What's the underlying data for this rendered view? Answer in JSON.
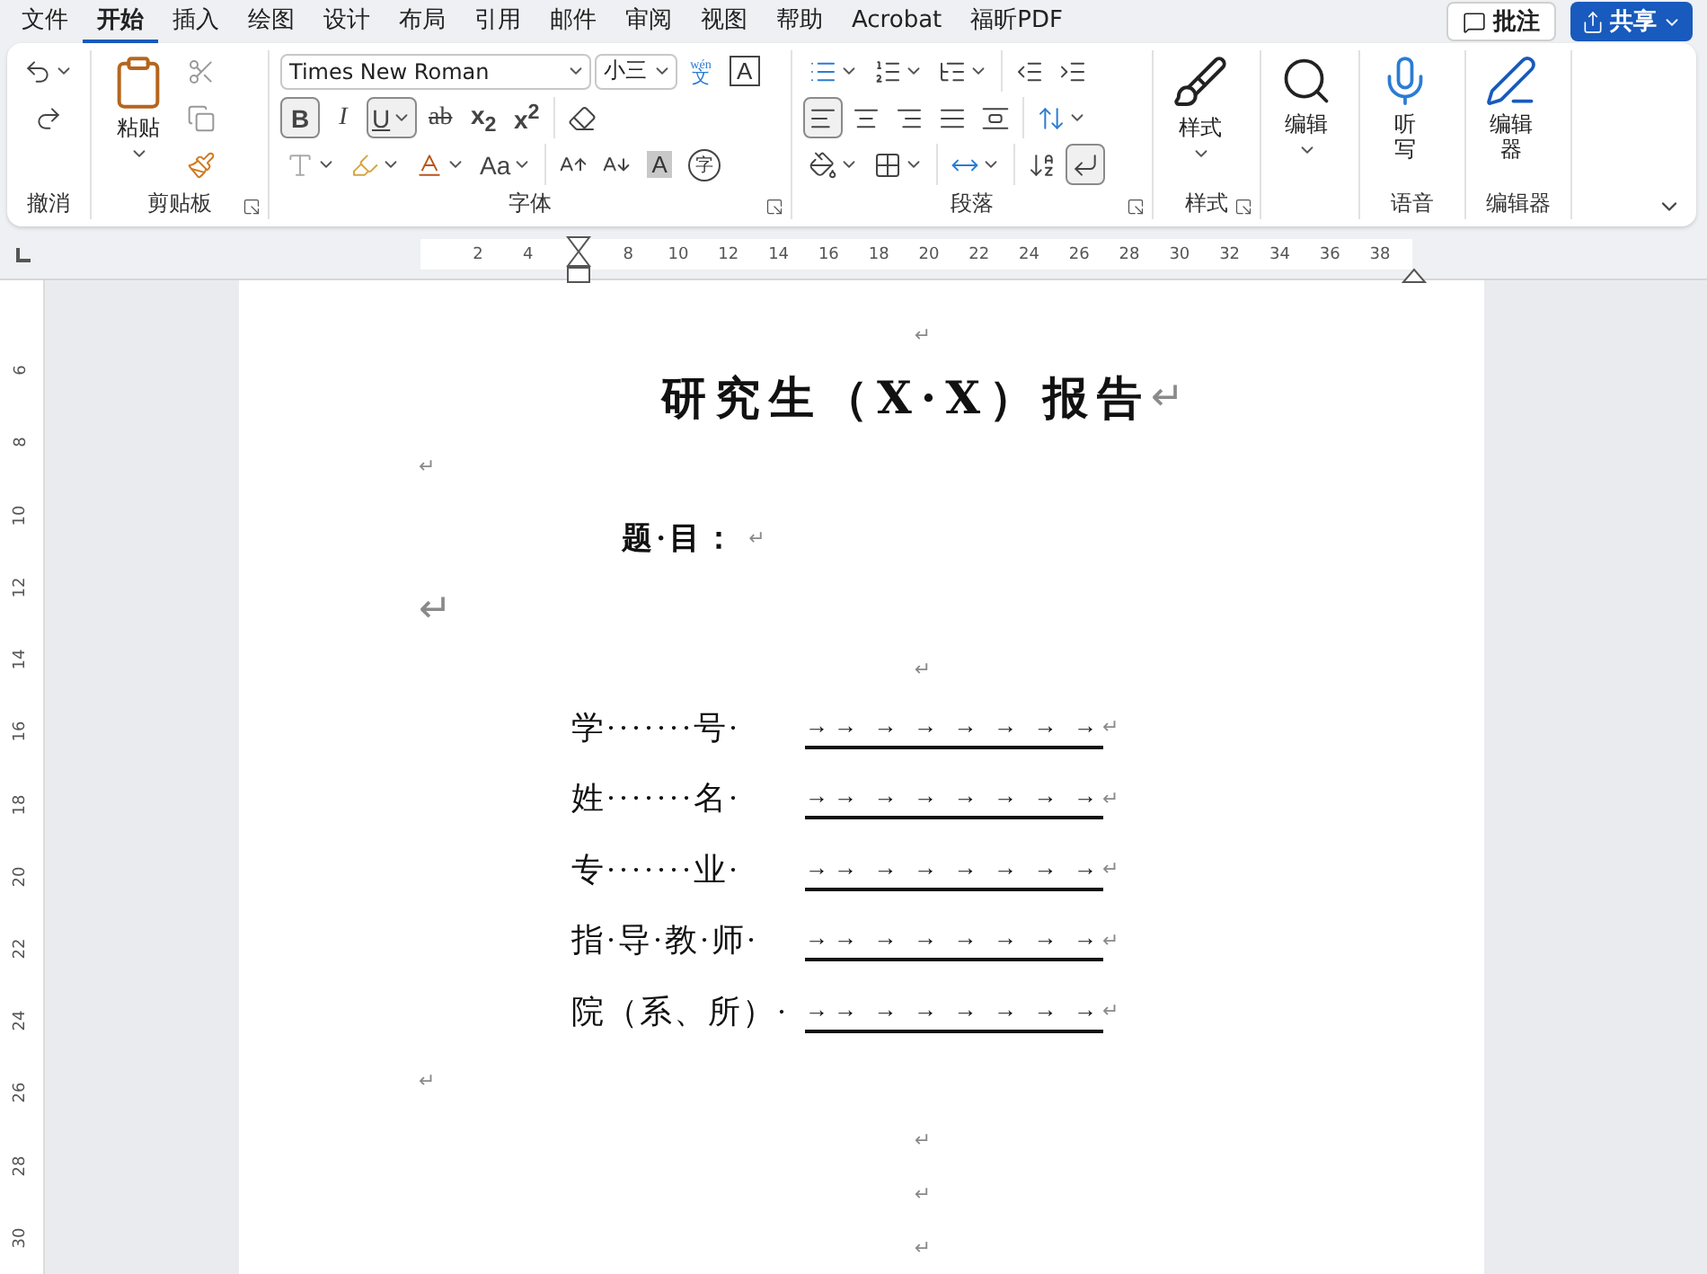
{
  "menu_tabs": [
    {
      "label": "文件",
      "selected": false
    },
    {
      "label": "开始",
      "selected": true
    },
    {
      "label": "插入",
      "selected": false
    },
    {
      "label": "绘图",
      "selected": false
    },
    {
      "label": "设计",
      "selected": false
    },
    {
      "label": "布局",
      "selected": false
    },
    {
      "label": "引用",
      "selected": false
    },
    {
      "label": "邮件",
      "selected": false
    },
    {
      "label": "审阅",
      "selected": false
    },
    {
      "label": "视图",
      "selected": false
    },
    {
      "label": "帮助",
      "selected": false
    },
    {
      "label": "Acrobat",
      "selected": false
    },
    {
      "label": "福昕PDF",
      "selected": false
    }
  ],
  "comments_button": "批注",
  "share_button": "共享",
  "ribbon": {
    "undo_group": "撤消",
    "clipboard": {
      "label": "剪贴板",
      "paste": "粘贴"
    },
    "font": {
      "label": "字体",
      "name": "Times New Roman",
      "size": "小三",
      "phonetic_ruby": "wén",
      "phonetic_base": "文",
      "char_border": "A",
      "change_case": "Aa",
      "char_shading": "A",
      "enclose_chars": "字",
      "format_buttons": [
        {
          "label": "B",
          "selected": true
        },
        {
          "label": "I",
          "selected": false
        },
        {
          "label": "U",
          "selected": true
        },
        {
          "label": "ab",
          "selected": false
        },
        {
          "label": "x$_{2}$",
          "selected": false
        },
        {
          "label": "x$^{2}$",
          "selected": false
        }
      ]
    },
    "paragraph": {
      "label": "段落",
      "alignment": [
        {
          "selected": true
        },
        {
          "selected": false
        },
        {
          "selected": false
        },
        {
          "selected": false
        },
        {
          "selected": false
        }
      ],
      "show_marks": {
        "selected": true
      }
    },
    "styles": {
      "label": "样式",
      "button": "样式"
    },
    "editing": {
      "button": "编辑"
    },
    "voice": {
      "label": "语音",
      "button": "听写"
    },
    "editor": {
      "label": "编辑器",
      "button": "编辑器"
    }
  },
  "ruler": {
    "ticks": [
      "2",
      "4",
      "8",
      "10",
      "12",
      "14",
      "16",
      "18",
      "20",
      "22",
      "24",
      "26",
      "28",
      "30",
      "32",
      "34",
      "36",
      "38"
    ],
    "vertical_ticks": [
      "6",
      "8",
      "10",
      "12",
      "14",
      "16",
      "18",
      "20",
      "22",
      "24",
      "26",
      "28",
      "30"
    ]
  },
  "document": {
    "paragraphs": [
      {
        "kind": "mark",
        "text": "↵"
      },
      {
        "kind": "title",
        "text": "研究生（X·X）报告",
        "mark": "↵"
      },
      {
        "kind": "left_mark",
        "text": "↵"
      },
      {
        "kind": "subject",
        "text": "题·目：",
        "mark": "↵"
      },
      {
        "kind": "large_mark",
        "text": "↵"
      },
      {
        "kind": "small_mark",
        "text": "↵"
      },
      {
        "kind": "form_row",
        "label": "学·······号·",
        "blank": "→→ → → → → → →",
        "mark": "↵"
      },
      {
        "kind": "form_row",
        "label": "姓·······名·",
        "blank": "→→ → → → → → →",
        "mark": "↵"
      },
      {
        "kind": "form_row",
        "label": "专·······业·",
        "blank": "→→ → → → → → →",
        "mark": "↵"
      },
      {
        "kind": "form_row",
        "label": "指·导·教·师·",
        "blank": "→→ → → → → → →",
        "mark": "↵"
      },
      {
        "kind": "form_row",
        "label": "院（系、所）·",
        "blank": "→→ → → → → → →",
        "mark": "↵"
      },
      {
        "kind": "left_mark",
        "text": "↵"
      },
      {
        "kind": "mark",
        "text": "↵"
      },
      {
        "kind": "mark",
        "text": "↵"
      },
      {
        "kind": "mark",
        "text": "↵"
      }
    ]
  }
}
